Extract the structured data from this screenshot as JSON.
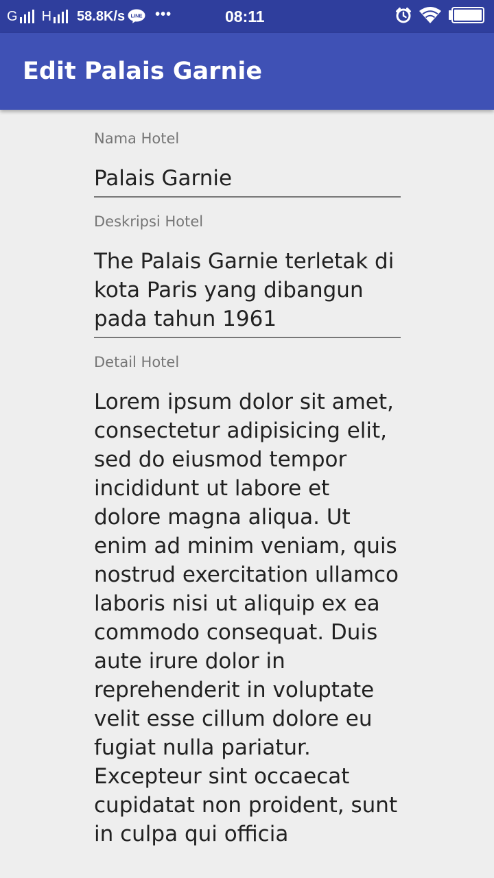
{
  "status_bar": {
    "carrier_1": "G",
    "carrier_2": "H",
    "speed": "58.8K/s",
    "line_label": "LINE",
    "more_dots": "•••",
    "time": "08:11",
    "icons": [
      "line-icon",
      "more-dots-icon",
      "alarm-icon",
      "wifi-icon",
      "battery-icon"
    ]
  },
  "app_bar": {
    "title": "Edit Palais Garnie"
  },
  "form": {
    "name_label": "Nama Hotel",
    "name_value": "Palais Garnie",
    "desc_label": "Deskripsi Hotel",
    "desc_value": "The Palais Garnie terletak di kota Paris yang dibangun pada tahun 1961",
    "detail_label": "Detail Hotel",
    "detail_value": "Lorem ipsum dolor sit amet, consectetur adipisicing elit, sed do eiusmod tempor incididunt ut labore et dolore magna aliqua. Ut enim ad minim veniam, quis nostrud exercitation ullamco laboris nisi ut aliquip ex ea commodo consequat. Duis aute irure dolor in reprehenderit in voluptate velit esse cillum dolore eu fugiat nulla pariatur. Excepteur sint occaecat cupidatat non proident, sunt in culpa qui officia"
  },
  "colors": {
    "status_bar": "#2f3e9d",
    "app_bar": "#3f51b5",
    "background": "#eeeeee",
    "label_text": "#757575",
    "input_text": "#212121",
    "underline": "#777777"
  }
}
